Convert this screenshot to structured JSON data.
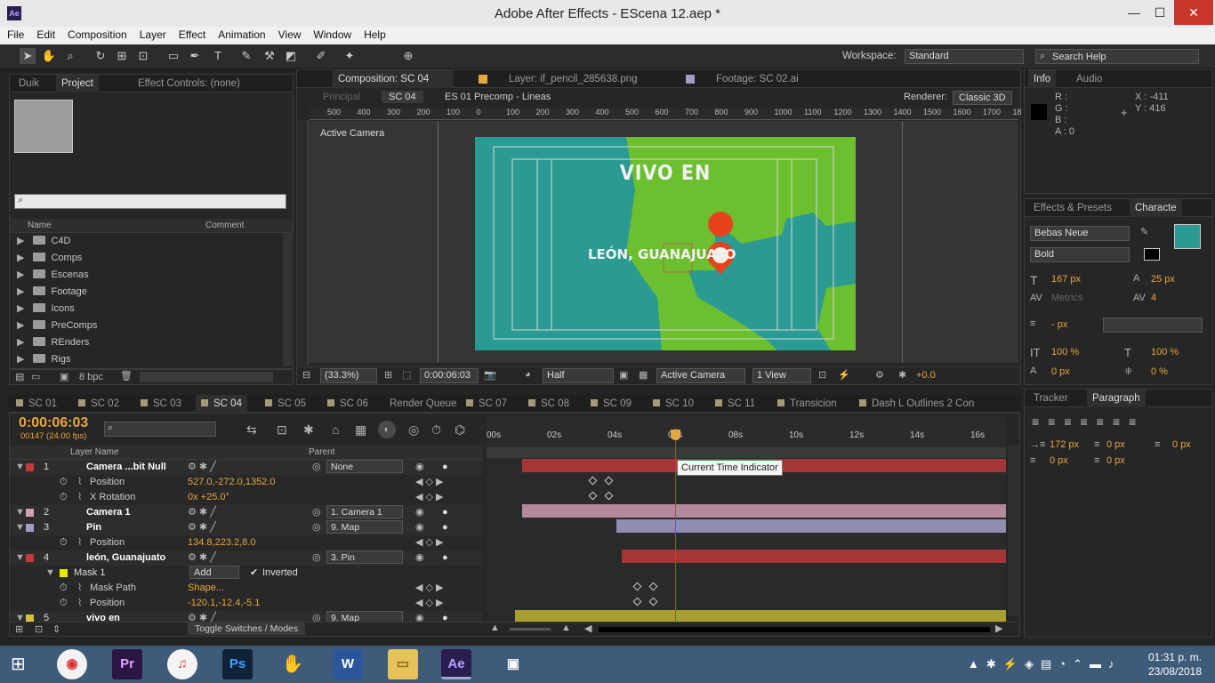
{
  "window": {
    "title": "Adobe After Effects - EScena 12.aep *",
    "minimize": "—",
    "maximize": "☐",
    "close": "✕"
  },
  "menu": [
    "File",
    "Edit",
    "Composition",
    "Layer",
    "Effect",
    "Animation",
    "View",
    "Window",
    "Help"
  ],
  "toolbar": {
    "workspace_label": "Workspace:",
    "workspace_value": "Standard",
    "search_placeholder": "Search Help"
  },
  "project_panel": {
    "tabs": [
      "Duik",
      "Project",
      "Effect Controls: (none)"
    ],
    "search_placeholder": "",
    "col_name": "Name",
    "col_comment": "Comment",
    "folders": [
      "C4D",
      "Comps",
      "Escenas",
      "Footage",
      "Icons",
      "PreComps",
      "REnders",
      "Rigs"
    ],
    "bpc": "8 bpc"
  },
  "viewer": {
    "tabs": [
      "Composition: SC 04",
      "Layer: if_pencil_285638.png",
      "Footage: SC 02.ai"
    ],
    "breadcrumbs": [
      "Principal",
      "SC 04",
      "ES 01 Precomp - Lineas"
    ],
    "renderer_label": "Renderer:",
    "renderer_value": "Classic 3D",
    "ruler": [
      "500",
      "400",
      "300",
      "200",
      "100",
      "0",
      "100",
      "200",
      "300",
      "400",
      "500",
      "600",
      "700",
      "800",
      "900",
      "1000",
      "1100",
      "1200",
      "1300",
      "1400",
      "1500",
      "1600",
      "1700",
      "18"
    ],
    "camera_label": "Active Camera",
    "comp_title": "VIVO EN",
    "comp_city": "LEÓN, GUANAJUATO",
    "zoom": "(33.3%)",
    "timecode": "0:00:06:03",
    "resolution": "Half",
    "camera": "Active Camera",
    "views": "1 View",
    "exposure": "+0.0"
  },
  "info_panel": {
    "tabs": [
      "Info",
      "Audio"
    ],
    "r": "R :",
    "g": "G :",
    "b": "B :",
    "a": "A : 0",
    "x": "X : -411",
    "y": "Y : 416"
  },
  "character_panel": {
    "tabs": [
      "Effects & Presets",
      "Characte"
    ],
    "font": "Bebas Neue",
    "style": "Bold",
    "size": "167 px",
    "leading": "25 px",
    "kerning": "Metrics",
    "tracking": "4",
    "stroke": "- px",
    "vscale": "100 %",
    "hscale": "100 %",
    "baseline": "0 px",
    "tsume": "0 %",
    "fill_color": "#2a9a93"
  },
  "paragraph_panel": {
    "tabs": [
      "Tracker",
      "Paragraph"
    ],
    "indent_left": "172 px",
    "indent_first": "0 px",
    "indent_right": "0 px",
    "space_before": "0 px",
    "space_after": "0 px"
  },
  "timeline": {
    "tabs": [
      "SC 01",
      "SC 02",
      "SC 03",
      "SC 04",
      "SC 05",
      "SC 06",
      "Render Queue",
      "SC 07",
      "SC 08",
      "SC 09",
      "SC 10",
      "SC 11",
      "Transicion",
      "Dash L Outlines 2 Con"
    ],
    "timecode": "0:00:06:03",
    "frames": "00147 (24.00 fps)",
    "col_layer": "Layer Name",
    "col_parent": "Parent",
    "ticks": [
      "00s",
      "02s",
      "04s",
      "06s",
      "08s",
      "10s",
      "12s",
      "14s",
      "16s"
    ],
    "tooltip": "Current Time Indicator",
    "toggle_label": "Toggle Switches / Modes",
    "rows": [
      {
        "num": "1",
        "name": "Camera ...bit Null",
        "parent": "None",
        "type": "layer"
      },
      {
        "name": "Position",
        "value": "527.0,-272.0,1352.0",
        "type": "prop"
      },
      {
        "name": "X Rotation",
        "value": "0x +25.0°",
        "type": "prop"
      },
      {
        "num": "2",
        "name": "Camera 1",
        "parent": "1. Camera 1",
        "type": "layer"
      },
      {
        "num": "3",
        "name": "Pin",
        "parent": "9. Map",
        "type": "layer"
      },
      {
        "name": "Position",
        "value": "134.8,223.2,8.0",
        "type": "prop"
      },
      {
        "num": "4",
        "name": "león, Guanajuato",
        "parent": "3. Pin",
        "type": "layer"
      },
      {
        "name": "Mask 1",
        "value": "Add",
        "extra": "Inverted",
        "type": "mask"
      },
      {
        "name": "Mask Path",
        "value": "Shape...",
        "type": "prop"
      },
      {
        "name": "Position",
        "value": "-120.1,-12.4,-5.1",
        "type": "prop"
      },
      {
        "num": "5",
        "name": "vivo en",
        "parent": "9. Map",
        "type": "layer"
      }
    ]
  },
  "taskbar": {
    "time": "01:31 p. m.",
    "date": "23/08/2018"
  }
}
